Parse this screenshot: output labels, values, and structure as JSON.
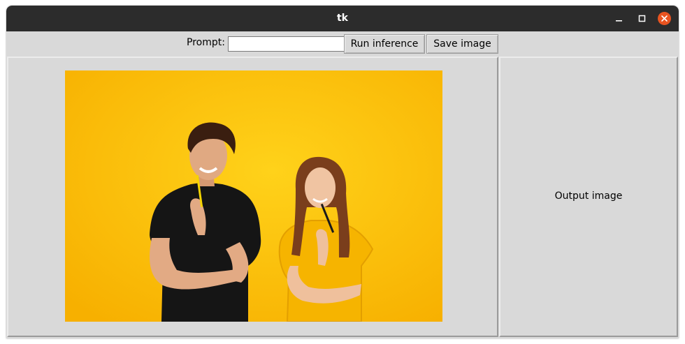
{
  "window": {
    "title": "tk",
    "controls": {
      "minimize_icon": "minimize-icon",
      "maximize_icon": "maximize-icon",
      "close_icon": "close-icon"
    },
    "close_color": "#e95420"
  },
  "toolbar": {
    "prompt_label": "Prompt:",
    "prompt_value": "",
    "run_label": "Run inference",
    "save_label": "Save image"
  },
  "input_panel": {
    "image_icon": "photo-couple-thinking-yellow-background",
    "background_color": "#fdbc0a"
  },
  "output_panel": {
    "placeholder": "Output image"
  }
}
